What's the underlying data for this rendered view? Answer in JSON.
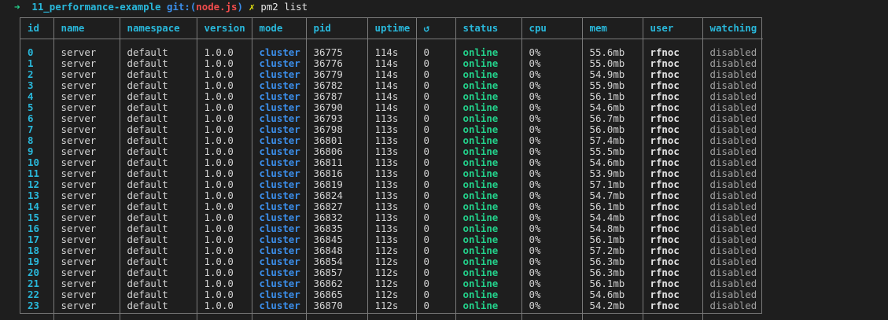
{
  "prompt": {
    "arrow": "➜",
    "directory": "11_performance-example",
    "git_label": "git:(",
    "branch": "node.js",
    "git_close": ")",
    "dirty_marker": "✗",
    "command": "pm2 list"
  },
  "table": {
    "headers": [
      "id",
      "name",
      "namespace",
      "version",
      "mode",
      "pid",
      "uptime",
      "↺",
      "status",
      "cpu",
      "mem",
      "user",
      "watching"
    ],
    "rows": [
      [
        "0",
        "server",
        "default",
        "1.0.0",
        "cluster",
        "36775",
        "114s",
        "0",
        "online",
        "0%",
        "55.6mb",
        "rfnoc",
        "disabled"
      ],
      [
        "1",
        "server",
        "default",
        "1.0.0",
        "cluster",
        "36776",
        "114s",
        "0",
        "online",
        "0%",
        "55.0mb",
        "rfnoc",
        "disabled"
      ],
      [
        "2",
        "server",
        "default",
        "1.0.0",
        "cluster",
        "36779",
        "114s",
        "0",
        "online",
        "0%",
        "54.9mb",
        "rfnoc",
        "disabled"
      ],
      [
        "3",
        "server",
        "default",
        "1.0.0",
        "cluster",
        "36782",
        "114s",
        "0",
        "online",
        "0%",
        "55.9mb",
        "rfnoc",
        "disabled"
      ],
      [
        "4",
        "server",
        "default",
        "1.0.0",
        "cluster",
        "36787",
        "114s",
        "0",
        "online",
        "0%",
        "56.1mb",
        "rfnoc",
        "disabled"
      ],
      [
        "5",
        "server",
        "default",
        "1.0.0",
        "cluster",
        "36790",
        "114s",
        "0",
        "online",
        "0%",
        "54.6mb",
        "rfnoc",
        "disabled"
      ],
      [
        "6",
        "server",
        "default",
        "1.0.0",
        "cluster",
        "36793",
        "113s",
        "0",
        "online",
        "0%",
        "56.7mb",
        "rfnoc",
        "disabled"
      ],
      [
        "7",
        "server",
        "default",
        "1.0.0",
        "cluster",
        "36798",
        "113s",
        "0",
        "online",
        "0%",
        "56.0mb",
        "rfnoc",
        "disabled"
      ],
      [
        "8",
        "server",
        "default",
        "1.0.0",
        "cluster",
        "36801",
        "113s",
        "0",
        "online",
        "0%",
        "57.4mb",
        "rfnoc",
        "disabled"
      ],
      [
        "9",
        "server",
        "default",
        "1.0.0",
        "cluster",
        "36806",
        "113s",
        "0",
        "online",
        "0%",
        "55.5mb",
        "rfnoc",
        "disabled"
      ],
      [
        "10",
        "server",
        "default",
        "1.0.0",
        "cluster",
        "36811",
        "113s",
        "0",
        "online",
        "0%",
        "54.6mb",
        "rfnoc",
        "disabled"
      ],
      [
        "11",
        "server",
        "default",
        "1.0.0",
        "cluster",
        "36816",
        "113s",
        "0",
        "online",
        "0%",
        "53.9mb",
        "rfnoc",
        "disabled"
      ],
      [
        "12",
        "server",
        "default",
        "1.0.0",
        "cluster",
        "36819",
        "113s",
        "0",
        "online",
        "0%",
        "57.1mb",
        "rfnoc",
        "disabled"
      ],
      [
        "13",
        "server",
        "default",
        "1.0.0",
        "cluster",
        "36824",
        "113s",
        "0",
        "online",
        "0%",
        "54.7mb",
        "rfnoc",
        "disabled"
      ],
      [
        "14",
        "server",
        "default",
        "1.0.0",
        "cluster",
        "36827",
        "113s",
        "0",
        "online",
        "0%",
        "56.1mb",
        "rfnoc",
        "disabled"
      ],
      [
        "15",
        "server",
        "default",
        "1.0.0",
        "cluster",
        "36832",
        "113s",
        "0",
        "online",
        "0%",
        "54.4mb",
        "rfnoc",
        "disabled"
      ],
      [
        "16",
        "server",
        "default",
        "1.0.0",
        "cluster",
        "36835",
        "113s",
        "0",
        "online",
        "0%",
        "54.8mb",
        "rfnoc",
        "disabled"
      ],
      [
        "17",
        "server",
        "default",
        "1.0.0",
        "cluster",
        "36845",
        "113s",
        "0",
        "online",
        "0%",
        "56.1mb",
        "rfnoc",
        "disabled"
      ],
      [
        "18",
        "server",
        "default",
        "1.0.0",
        "cluster",
        "36848",
        "112s",
        "0",
        "online",
        "0%",
        "57.2mb",
        "rfnoc",
        "disabled"
      ],
      [
        "19",
        "server",
        "default",
        "1.0.0",
        "cluster",
        "36854",
        "112s",
        "0",
        "online",
        "0%",
        "56.3mb",
        "rfnoc",
        "disabled"
      ],
      [
        "20",
        "server",
        "default",
        "1.0.0",
        "cluster",
        "36857",
        "112s",
        "0",
        "online",
        "0%",
        "56.3mb",
        "rfnoc",
        "disabled"
      ],
      [
        "21",
        "server",
        "default",
        "1.0.0",
        "cluster",
        "36862",
        "112s",
        "0",
        "online",
        "0%",
        "56.1mb",
        "rfnoc",
        "disabled"
      ],
      [
        "22",
        "server",
        "default",
        "1.0.0",
        "cluster",
        "36865",
        "112s",
        "0",
        "online",
        "0%",
        "54.6mb",
        "rfnoc",
        "disabled"
      ],
      [
        "23",
        "server",
        "default",
        "1.0.0",
        "cluster",
        "36870",
        "112s",
        "0",
        "online",
        "0%",
        "54.2mb",
        "rfnoc",
        "disabled"
      ]
    ]
  },
  "colors": {
    "background": "#1e1e1e",
    "accent_cyan": "#29b8db",
    "accent_blue": "#3b8eea",
    "status_green": "#23d18b",
    "branch_red": "#f14c4c",
    "marker_yellow": "#e5e510",
    "border": "#7a7a7a"
  }
}
